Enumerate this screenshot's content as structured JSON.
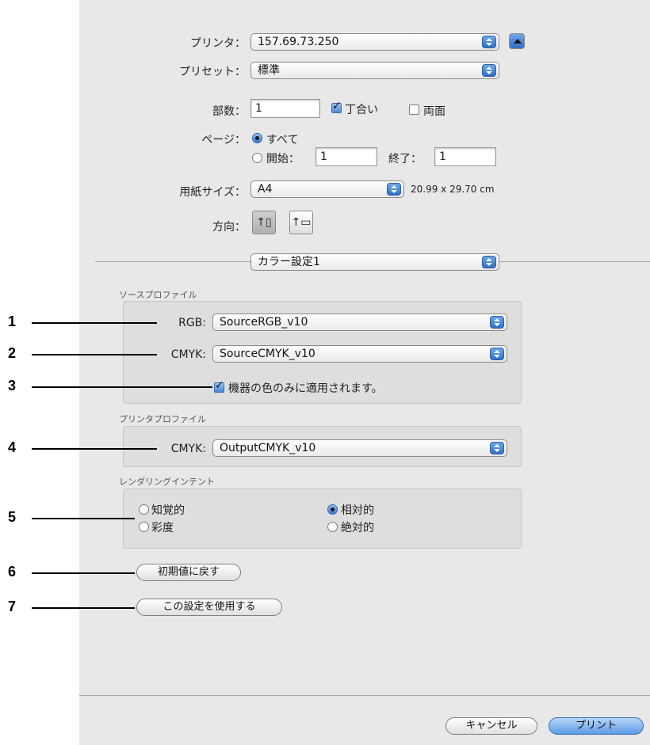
{
  "printer": {
    "label": "プリンタ：",
    "value": "157.69.73.250"
  },
  "preset": {
    "label": "プリセット：",
    "value": "標準"
  },
  "copies": {
    "label": "部数：",
    "value": "1",
    "collate_label": "丁合い",
    "duplex_label": "両面",
    "collate_checked": true,
    "duplex_checked": false
  },
  "pages": {
    "label": "ページ：",
    "all_label": "すべて",
    "from_label": "開始：",
    "from_value": "1",
    "to_label": "終了：",
    "to_value": "1"
  },
  "paper": {
    "label": "用紙サイズ：",
    "value": "A4",
    "dimensions": "20.99 x 29.70 cm"
  },
  "orientation": {
    "label": "方向："
  },
  "panel_select": {
    "value": "カラー設定1"
  },
  "source_profile": {
    "title": "ソースプロファイル",
    "rgb_label": "RGB:",
    "rgb_value": "SourceRGB_v10",
    "cmyk_label": "CMYK:",
    "cmyk_value": "SourceCMYK_v10",
    "device_only_label": "機器の色のみに適用されます。",
    "device_only_checked": true
  },
  "printer_profile": {
    "title": "プリンタプロファイル",
    "cmyk_label": "CMYK:",
    "cmyk_value": "OutputCMYK_v10"
  },
  "rendering_intent": {
    "title": "レンダリングインテント",
    "options": [
      "知覚的",
      "相対的",
      "彩度",
      "絶対的"
    ],
    "selected": "相対的"
  },
  "reset_button": "初期値に戻す",
  "use_settings_button": "この設定を使用する",
  "cancel_button": "キャンセル",
  "print_button": "プリント",
  "callouts": [
    "1",
    "2",
    "3",
    "4",
    "5",
    "6",
    "7"
  ]
}
